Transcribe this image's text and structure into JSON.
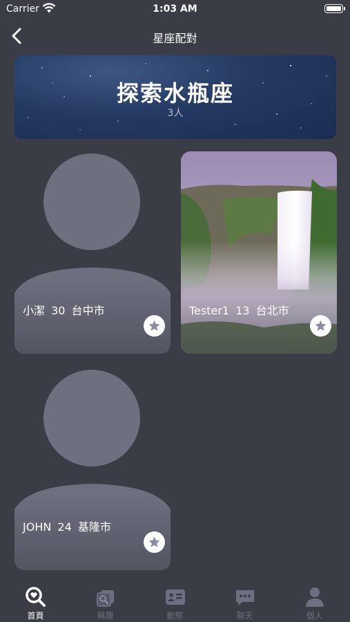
{
  "status_bar": {
    "carrier": "Carrier",
    "time": "1:03 AM"
  },
  "nav": {
    "title": "星座配對"
  },
  "banner": {
    "title": "探索水瓶座",
    "count": "3人"
  },
  "profiles": [
    {
      "name": "小潔",
      "age": "30",
      "city": "台中市",
      "photo": "placeholder-avatar"
    },
    {
      "name": "Tester1",
      "age": "13",
      "city": "台北市",
      "photo": "waterfall-landscape"
    },
    {
      "name": "JOHN",
      "age": "24",
      "city": "基隆市",
      "photo": "placeholder-avatar"
    }
  ],
  "tabs": [
    {
      "label": "首頁",
      "icon": "search-heart-icon",
      "active": true
    },
    {
      "label": "興趣",
      "icon": "interest-icon",
      "active": false
    },
    {
      "label": "動態",
      "icon": "feed-icon",
      "active": false
    },
    {
      "label": "聊天",
      "icon": "chat-icon",
      "active": false
    },
    {
      "label": "個人",
      "icon": "person-icon",
      "active": false
    }
  ],
  "colors": {
    "background": "#3a3c46",
    "placeholder": "#6e7080",
    "tab_inactive": "#6d7080"
  }
}
